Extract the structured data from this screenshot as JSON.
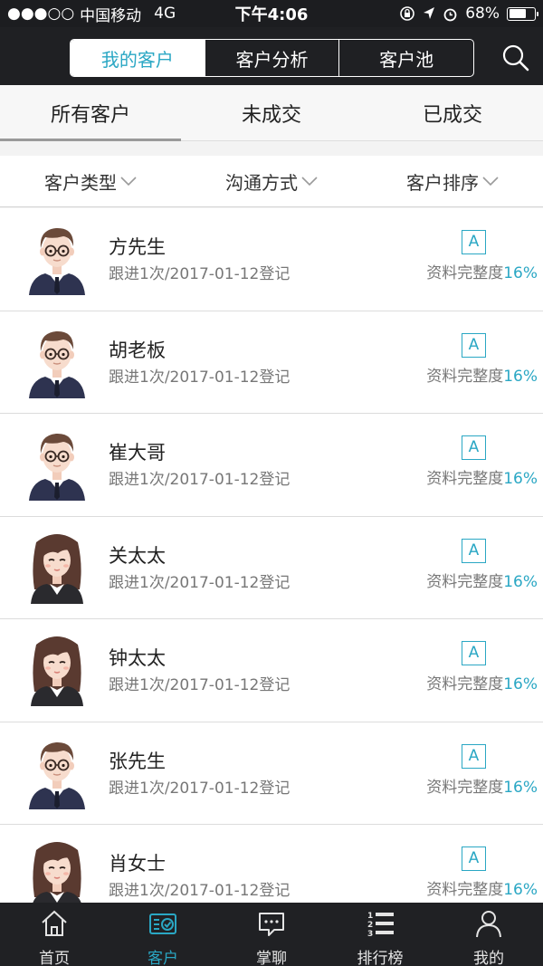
{
  "status": {
    "signal": "●●●○○",
    "carrier": "中国移动",
    "network": "4G",
    "time": "下午4:06",
    "battery": "68%",
    "battery_level": 0.68
  },
  "header": {
    "segments": [
      "我的客户",
      "客户分析",
      "客户池"
    ],
    "active_segment": 0,
    "search_icon": "search-icon"
  },
  "tabs": [
    "所有客户",
    "未成交",
    "已成交"
  ],
  "filters": [
    "客户类型",
    "沟通方式",
    "客户排序"
  ],
  "customers": [
    {
      "name": "方先生",
      "meta": "跟进1次/2017-01-12登记",
      "grade": "A",
      "completeness_label": "资料完整度",
      "completeness": "16%",
      "gender": "male"
    },
    {
      "name": "胡老板",
      "meta": "跟进1次/2017-01-12登记",
      "grade": "A",
      "completeness_label": "资料完整度",
      "completeness": "16%",
      "gender": "male"
    },
    {
      "name": "崔大哥",
      "meta": "跟进1次/2017-01-12登记",
      "grade": "A",
      "completeness_label": "资料完整度",
      "completeness": "16%",
      "gender": "male"
    },
    {
      "name": "关太太",
      "meta": "跟进1次/2017-01-12登记",
      "grade": "A",
      "completeness_label": "资料完整度",
      "completeness": "16%",
      "gender": "female"
    },
    {
      "name": "钟太太",
      "meta": "跟进1次/2017-01-12登记",
      "grade": "A",
      "completeness_label": "资料完整度",
      "completeness": "16%",
      "gender": "female"
    },
    {
      "name": "张先生",
      "meta": "跟进1次/2017-01-12登记",
      "grade": "A",
      "completeness_label": "资料完整度",
      "completeness": "16%",
      "gender": "male"
    },
    {
      "name": "肖女士",
      "meta": "跟进1次/2017-01-12登记",
      "grade": "A",
      "completeness_label": "资料完整度",
      "completeness": "16%",
      "gender": "female"
    }
  ],
  "bottom_nav": [
    {
      "label": "首页",
      "icon": "home-icon"
    },
    {
      "label": "客户",
      "icon": "customer-card-icon"
    },
    {
      "label": "掌聊",
      "icon": "chat-icon"
    },
    {
      "label": "排行榜",
      "icon": "ranking-list-icon"
    },
    {
      "label": "我的",
      "icon": "profile-icon"
    }
  ],
  "active_nav": 1,
  "colors": {
    "accent": "#2aa7c4",
    "header_bg": "#1f2023",
    "nav_bg": "#202124"
  }
}
